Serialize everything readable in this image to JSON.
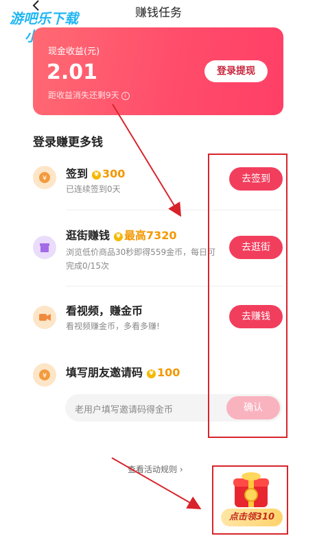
{
  "header": {
    "title": "赚钱任务",
    "back_icon": "chevron-left-icon"
  },
  "watermark": {
    "line1": "游吧乐下载",
    "line2": "小编亲测"
  },
  "earnings": {
    "label": "现金收益(元)",
    "amount": "2.01",
    "note": "距收益消失还剩9天",
    "withdraw_label": "登录提现"
  },
  "section_title": "登录赚更多钱",
  "tasks": [
    {
      "name": "签到",
      "reward": "300",
      "desc": "已连续签到0天",
      "button": "去签到",
      "icon": "yuan-coin-icon",
      "icon_color": "#fde5c8"
    },
    {
      "name": "逛街赚钱",
      "reward": "最高7320",
      "desc": "浏览低价商品30秒即得559金币，每日可完成0/15次",
      "button": "去逛街",
      "icon": "store-icon",
      "icon_color": "#eadcfb"
    },
    {
      "name": "看视频，赚金币",
      "reward": "",
      "desc": "看视频赚金币，多看多赚!",
      "button": "去赚钱",
      "icon": "video-camera-icon",
      "icon_color": "#fde5c8"
    },
    {
      "name": "填写朋友邀请码",
      "reward": "100",
      "desc": "",
      "button": "",
      "icon": "yuan-coin-icon",
      "icon_color": "#fde5c8"
    }
  ],
  "invite": {
    "placeholder": "老用户填写邀请码得金币",
    "confirm_label": "确认"
  },
  "rules_link": "查看活动规则 ›",
  "gift": {
    "label": "点击领310"
  },
  "colors": {
    "accent": "#f23e5d",
    "reward": "#f39800",
    "annotation": "#d8232a"
  }
}
